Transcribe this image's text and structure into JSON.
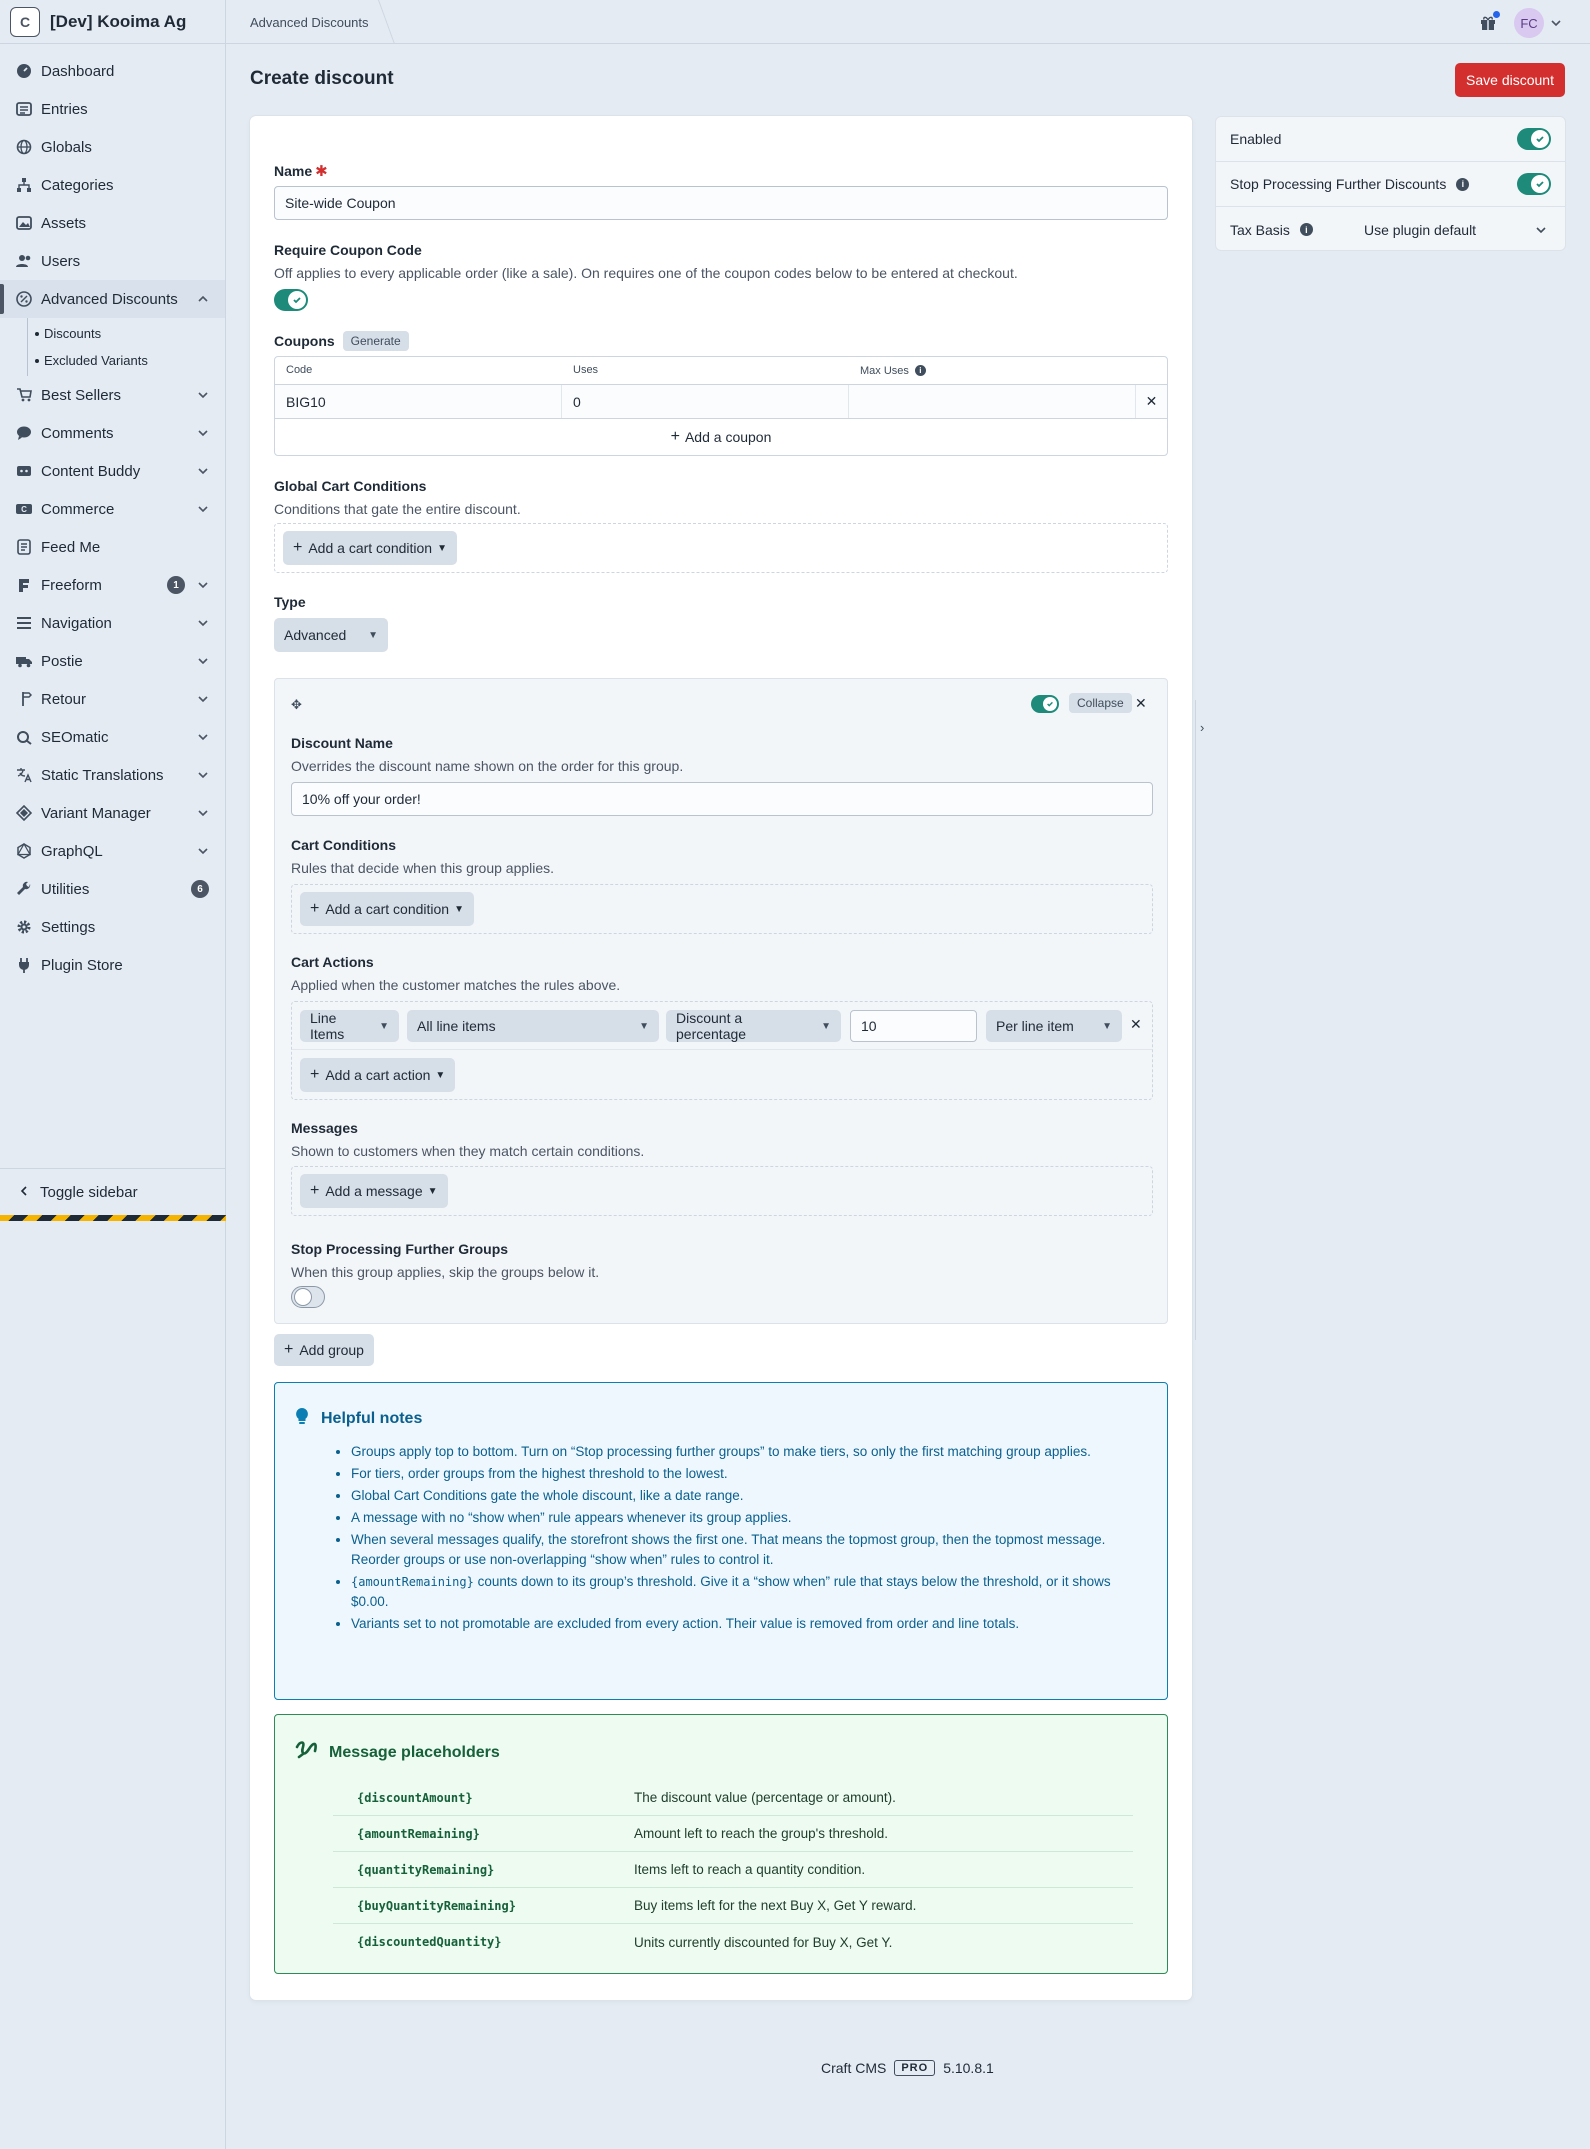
{
  "site": {
    "logo_letter": "C",
    "name": "[Dev] Kooima Ag"
  },
  "nav": {
    "items": [
      {
        "label": "Dashboard",
        "icon": "gauge-icon"
      },
      {
        "label": "Entries",
        "icon": "newspaper-icon"
      },
      {
        "label": "Globals",
        "icon": "globe-icon"
      },
      {
        "label": "Categories",
        "icon": "sitemap-icon"
      },
      {
        "label": "Assets",
        "icon": "image-icon"
      },
      {
        "label": "Users",
        "icon": "users-icon"
      },
      {
        "label": "Advanced Discounts",
        "icon": "percent-icon"
      },
      {
        "label": "Best Sellers",
        "icon": "cart-icon"
      },
      {
        "label": "Comments",
        "icon": "comment-icon"
      },
      {
        "label": "Content Buddy",
        "icon": "content-buddy-icon"
      },
      {
        "label": "Commerce",
        "icon": "commerce-icon"
      },
      {
        "label": "Feed Me",
        "icon": "feed-icon"
      },
      {
        "label": "Freeform",
        "icon": "freeform-icon",
        "badge": "1"
      },
      {
        "label": "Navigation",
        "icon": "bars-icon"
      },
      {
        "label": "Postie",
        "icon": "truck-icon"
      },
      {
        "label": "Retour",
        "icon": "signpost-icon"
      },
      {
        "label": "SEOmatic",
        "icon": "seomatic-icon"
      },
      {
        "label": "Static Translations",
        "icon": "translate-icon"
      },
      {
        "label": "Variant Manager",
        "icon": "variant-icon"
      },
      {
        "label": "GraphQL",
        "icon": "graphql-icon"
      },
      {
        "label": "Utilities",
        "icon": "wrench-icon",
        "badge": "6"
      },
      {
        "label": "Settings",
        "icon": "gear-icon"
      },
      {
        "label": "Plugin Store",
        "icon": "plug-icon"
      }
    ],
    "subitems": [
      "Discounts",
      "Excluded Variants"
    ],
    "toggle_label": "Toggle sidebar"
  },
  "topbar": {
    "breadcrumb": "Advanced Discounts",
    "avatar_initials": "FC"
  },
  "page": {
    "title": "Create discount",
    "save_label": "Save discount"
  },
  "form": {
    "name_label": "Name",
    "name_value": "Site-wide Coupon",
    "require_label": "Require Coupon Code",
    "require_instr": "Off applies to every applicable order (like a sale). On requires one of the coupon codes below to be entered at checkout.",
    "coupons_label": "Coupons",
    "generate_label": "Generate",
    "coupon_cols": [
      "Code",
      "Uses",
      "Max Uses"
    ],
    "coupon_rows": [
      {
        "code": "BIG10",
        "uses": "0",
        "max": ""
      }
    ],
    "add_coupon": "Add a coupon",
    "global_label": "Global Cart Conditions",
    "global_instr": "Conditions that gate the entire discount.",
    "add_cart_condition": "Add a cart condition",
    "type_label": "Type",
    "type_value": "Advanced"
  },
  "group": {
    "collapse_label": "Collapse",
    "name_label": "Discount Name",
    "name_instr": "Overrides the discount name shown on the order for this group.",
    "name_value": "10% off your order!",
    "cond_label": "Cart Conditions",
    "cond_instr": "Rules that decide when this group applies.",
    "add_cart_condition": "Add a cart condition",
    "actions_label": "Cart Actions",
    "actions_instr": "Applied when the customer matches the rules above.",
    "action": {
      "target": "Line Items",
      "scope": "All line items",
      "kind": "Discount a percentage",
      "amount": "10",
      "per": "Per line item"
    },
    "add_cart_action": "Add a cart action",
    "messages_label": "Messages",
    "messages_instr": "Shown to customers when they match certain conditions.",
    "add_message": "Add a message",
    "stop_label": "Stop Processing Further Groups",
    "stop_instr": "When this group applies, skip the groups below it."
  },
  "add_group": "Add group",
  "notes": {
    "title": "Helpful notes",
    "items": [
      "Groups apply top to bottom. Turn on “Stop processing further groups” to make tiers, so only the first matching group applies.",
      "For tiers, order groups from the highest threshold to the lowest.",
      "Global Cart Conditions gate the whole discount, like a date range.",
      "A message with no “show when” rule appears whenever its group applies.",
      "When several messages qualify, the storefront shows the first one. That means the topmost group, then the topmost message. Reorder groups or use non-overlapping “show when” rules to control it.",
      "Variants set to not promotable are excluded from every action. Their value is removed from order and line totals."
    ],
    "code_item_code": "{amountRemaining}",
    "code_item_text": " counts down to its group’s threshold. Give it a “show when” rule that stays below the threshold, or it shows $0.00."
  },
  "placeholders": {
    "title": "Message placeholders",
    "rows": [
      {
        "key": "{discountAmount}",
        "desc": "The discount value (percentage or amount)."
      },
      {
        "key": "{amountRemaining}",
        "desc": "Amount left to reach the group's threshold."
      },
      {
        "key": "{quantityRemaining}",
        "desc": "Items left to reach a quantity condition."
      },
      {
        "key": "{buyQuantityRemaining}",
        "desc": "Buy items left for the next Buy X, Get Y reward."
      },
      {
        "key": "{discountedQuantity}",
        "desc": "Units currently discounted for Buy X, Get Y."
      }
    ]
  },
  "side": {
    "enabled_label": "Enabled",
    "stop_label": "Stop Processing Further Discounts",
    "tax_label": "Tax Basis",
    "tax_value": "Use plugin default"
  },
  "footer": {
    "product": "Craft CMS",
    "edition": "PRO",
    "version": "5.10.8.1"
  }
}
